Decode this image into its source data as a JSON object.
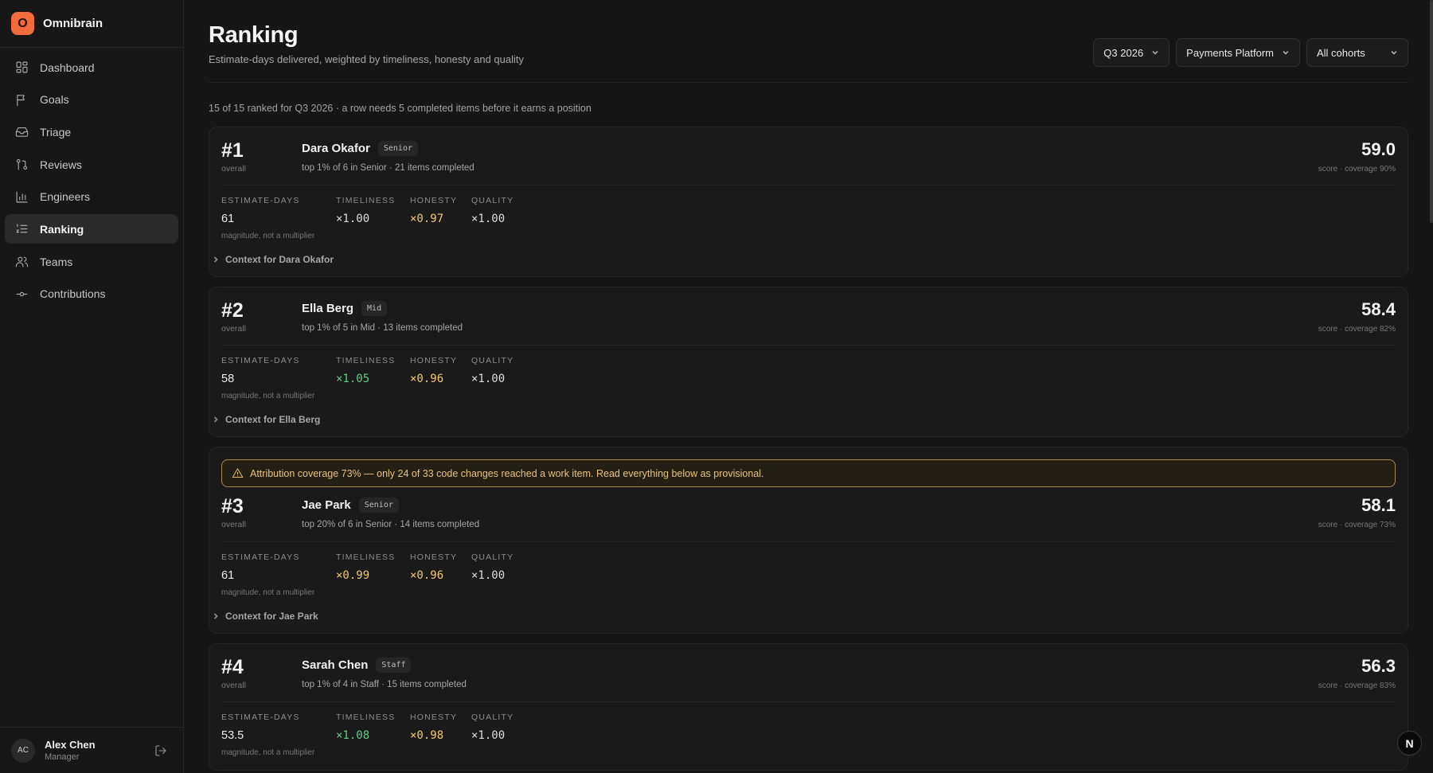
{
  "app": {
    "logo_letter": "O",
    "name": "Omnibrain"
  },
  "sidebar": {
    "items": [
      {
        "label": "Dashboard",
        "icon": "dashboard-icon",
        "active": false
      },
      {
        "label": "Goals",
        "icon": "flag-icon",
        "active": false
      },
      {
        "label": "Triage",
        "icon": "inbox-icon",
        "active": false
      },
      {
        "label": "Reviews",
        "icon": "git-pull-request-icon",
        "active": false
      },
      {
        "label": "Engineers",
        "icon": "bar-chart-icon",
        "active": false
      },
      {
        "label": "Ranking",
        "icon": "list-ordered-icon",
        "active": true
      },
      {
        "label": "Teams",
        "icon": "users-icon",
        "active": false
      },
      {
        "label": "Contributions",
        "icon": "git-commit-icon",
        "active": false
      }
    ]
  },
  "user": {
    "initials": "AC",
    "name": "Alex Chen",
    "role": "Manager"
  },
  "header": {
    "title": "Ranking",
    "subtitle": "Estimate-days delivered, weighted by timeliness, honesty and quality",
    "filters": {
      "quarter": "Q3 2026",
      "team": "Payments Platform",
      "cohort": "All cohorts"
    }
  },
  "summary": "15 of 15 ranked for Q3 2026 · a row needs 5 completed items before it earns a position",
  "labels": {
    "overall": "overall",
    "estimate_days": "ESTIMATE-DAYS",
    "timeliness": "TIMELINESS",
    "honesty": "HONESTY",
    "quality": "QUALITY",
    "magnitude_note": "magnitude, not a multiplier"
  },
  "rankings": [
    {
      "rank": "#1",
      "name": "Dara Okafor",
      "level": "Senior",
      "detail": "top 1% of 6 in Senior · 21 items completed",
      "score": "59.0",
      "score_sub": "score · coverage 90%",
      "estimate_days": "61",
      "timeliness": "×1.00",
      "honesty": "×0.97",
      "quality": "×1.00",
      "context": "Context for Dara Okafor"
    },
    {
      "rank": "#2",
      "name": "Ella Berg",
      "level": "Mid",
      "detail": "top 1% of 5 in Mid · 13 items completed",
      "score": "58.4",
      "score_sub": "score · coverage 82%",
      "estimate_days": "58",
      "timeliness": "×1.05",
      "honesty": "×0.96",
      "quality": "×1.00",
      "context": "Context for Ella Berg"
    },
    {
      "warning": "Attribution coverage 73% — only 24 of 33 code changes reached a work item. Read everything below as provisional.",
      "rank": "#3",
      "name": "Jae Park",
      "level": "Senior",
      "detail": "top 20% of 6 in Senior · 14 items completed",
      "score": "58.1",
      "score_sub": "score · coverage 73%",
      "estimate_days": "61",
      "timeliness": "×0.99",
      "honesty": "×0.96",
      "quality": "×1.00",
      "context": "Context for Jae Park"
    },
    {
      "rank": "#4",
      "name": "Sarah Chen",
      "level": "Staff",
      "detail": "top 1% of 4 in Staff · 15 items completed",
      "score": "56.3",
      "score_sub": "score · coverage 83%",
      "estimate_days": "53.5",
      "timeliness": "×1.08",
      "honesty": "×0.98",
      "quality": "×1.00"
    }
  ],
  "fab_letter": "N",
  "colors": {
    "accent": "#f26b3a",
    "positive": "#5fcf82",
    "caution": "#f1c86e",
    "warning_border": "#a8874a"
  }
}
